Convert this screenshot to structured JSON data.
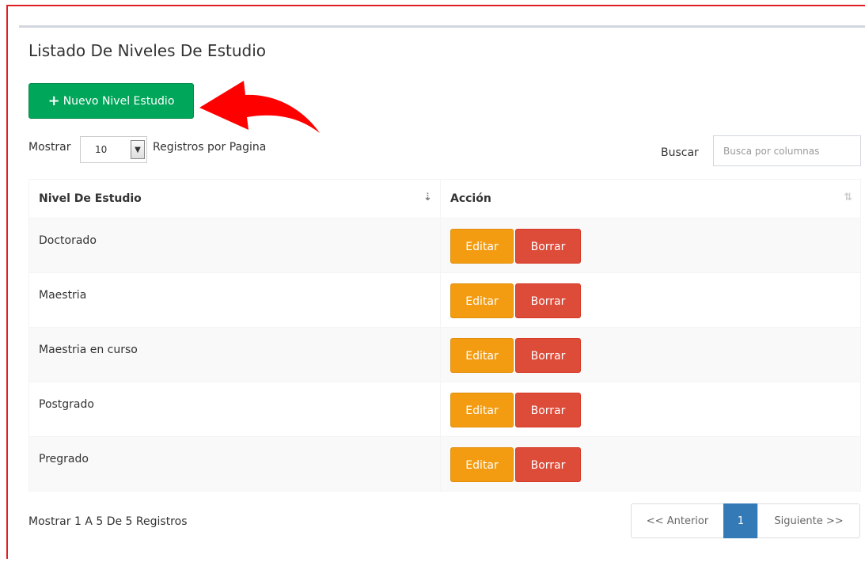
{
  "panel": {
    "title": "Listado De Niveles De Estudio"
  },
  "toolbar": {
    "new_label": "Nuevo Nivel Estudio"
  },
  "length": {
    "prefix": "Mostrar",
    "value": "10",
    "suffix": "Registros por Pagina"
  },
  "search": {
    "label": "Buscar",
    "placeholder": "Busca por columnas"
  },
  "table": {
    "headers": [
      "Nivel De Estudio",
      "Acción"
    ],
    "rows": [
      {
        "name": "Doctorado"
      },
      {
        "name": "Maestria"
      },
      {
        "name": "Maestria en curso"
      },
      {
        "name": "Postgrado"
      },
      {
        "name": "Pregrado"
      }
    ],
    "edit_label": "Editar",
    "delete_label": "Borrar"
  },
  "footer": {
    "info": "Mostrar 1 A 5 De 5 Registros"
  },
  "pagination": {
    "prev": "<< Anterior",
    "current": "1",
    "next": "Siguiente >>"
  },
  "icons": {
    "add": "plus-icon",
    "sort_active": "sort-amount-icon",
    "sort": "sort-icon",
    "dropdown": "caret-down-icon",
    "annotation": "red-arrow"
  },
  "colors": {
    "success": "#00a65a",
    "warning": "#f39c12",
    "danger": "#dd4b39",
    "primary": "#337ab7",
    "annotation": "#ff0000"
  }
}
